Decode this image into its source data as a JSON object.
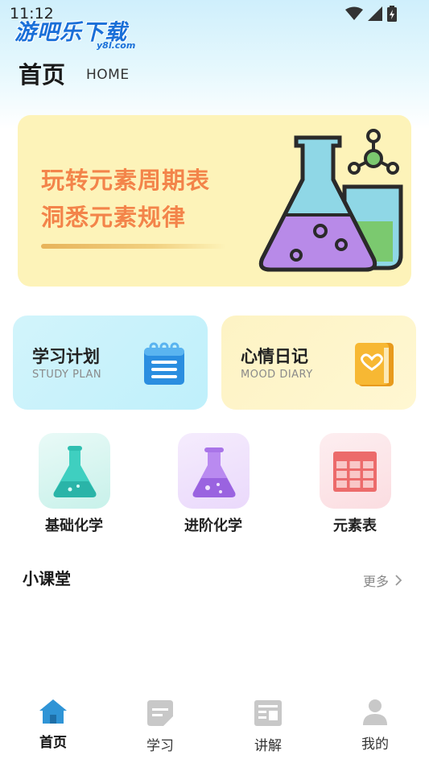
{
  "status": {
    "time": "11:12"
  },
  "watermark": {
    "text": "游吧乐下载",
    "sub": "y8l.com"
  },
  "header": {
    "title": "首页",
    "subtitle": "HOME"
  },
  "banner": {
    "line1": "玩转元素周期表",
    "line2": "洞悉元素规律"
  },
  "cards": [
    {
      "title": "学习计划",
      "subtitle": "STUDY PLAN",
      "icon": "notepad-icon"
    },
    {
      "title": "心情日记",
      "subtitle": "MOOD DIARY",
      "icon": "heart-book-icon"
    }
  ],
  "categories": [
    {
      "label": "基础化学",
      "icon": "flask-icon"
    },
    {
      "label": "进阶化学",
      "icon": "flask-icon"
    },
    {
      "label": "元素表",
      "icon": "table-grid-icon"
    }
  ],
  "section": {
    "title": "小课堂",
    "more": "更多"
  },
  "tabs": [
    {
      "label": "首页",
      "icon": "home-icon",
      "active": true
    },
    {
      "label": "学习",
      "icon": "notes-icon",
      "active": false
    },
    {
      "label": "讲解",
      "icon": "article-icon",
      "active": false
    },
    {
      "label": "我的",
      "icon": "user-icon",
      "active": false
    }
  ],
  "colors": {
    "accent": "#2f94d6",
    "banner_bg": "#fdf3b9",
    "banner_text": "#f3844a",
    "tab_inactive": "#c8c8c8"
  }
}
